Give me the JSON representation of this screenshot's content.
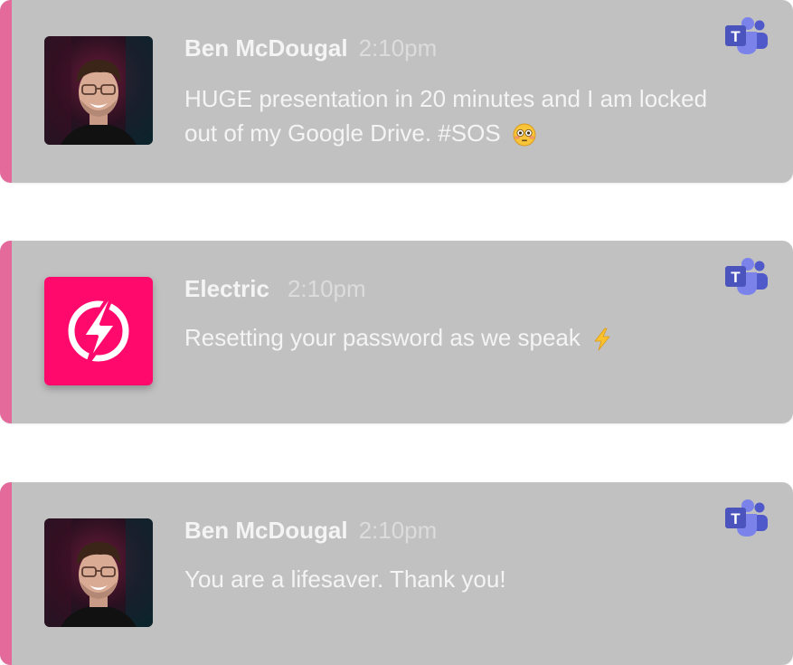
{
  "messages": [
    {
      "sender": "Ben McDougal",
      "time": "2:10pm",
      "text": "HUGE presentation in 20 minutes and I am locked out of my Google Drive. #SOS",
      "emoji": "flushed-face-emoji",
      "avatar": "person-photo"
    },
    {
      "sender": "Electric",
      "time": "2:10pm",
      "text": "Resetting your password as we speak",
      "emoji": "lightning-emoji",
      "avatar": "electric-logo"
    },
    {
      "sender": "Ben McDougal",
      "time": "2:10pm",
      "text": "You are a lifesaver. Thank you!",
      "emoji": "",
      "avatar": "person-photo"
    }
  ],
  "colors": {
    "card_bg": "#c1c1c1",
    "accent": "#e36a9b",
    "electric_brand": "#ff0a6c",
    "teams_purple": "#5059c9"
  },
  "app_icon": "microsoft-teams-icon"
}
